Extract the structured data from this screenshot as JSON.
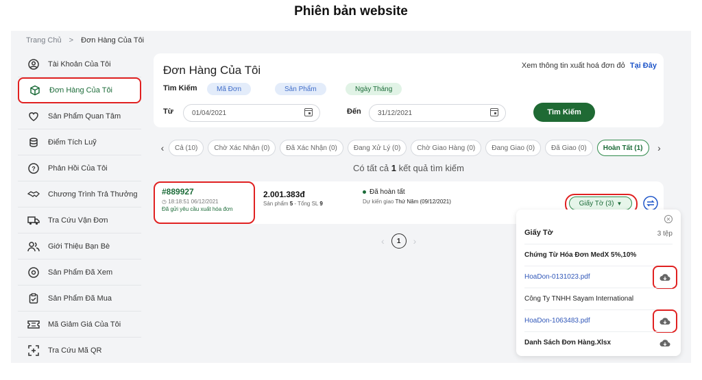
{
  "page_heading": "Phiên bản website",
  "breadcrumb": {
    "home": "Trang Chủ",
    "separator": ">",
    "current": "Đơn Hàng Của Tôi"
  },
  "sidebar": {
    "items": [
      {
        "label": "Tài Khoản Của Tôi",
        "icon": "user-circle-icon"
      },
      {
        "label": "Đơn Hàng Của Tôi",
        "icon": "box-icon"
      },
      {
        "label": "Sản Phẩm Quan Tâm",
        "icon": "heart-icon"
      },
      {
        "label": "Điểm Tích Luỹ",
        "icon": "coins-icon"
      },
      {
        "label": "Phản Hồi Của Tôi",
        "icon": "question-icon"
      },
      {
        "label": "Chương Trình Trả Thưởng",
        "icon": "handshake-icon"
      },
      {
        "label": "Tra Cứu Vận Đơn",
        "icon": "truck-icon"
      },
      {
        "label": "Giới Thiệu Bạn Bè",
        "icon": "users-icon"
      },
      {
        "label": "Sản Phẩm Đã Xem",
        "icon": "eye-icon"
      },
      {
        "label": "Sản Phẩm Đã Mua",
        "icon": "clipboard-icon"
      },
      {
        "label": "Mã Giảm Giá Của Tôi",
        "icon": "ticket-icon"
      },
      {
        "label": "Tra Cứu Mã QR",
        "icon": "qr-scan-icon"
      }
    ]
  },
  "search": {
    "title": "Đơn Hàng Của Tôi",
    "invoice_note": "Xem thông tin xuất hoá đơn đỏ",
    "invoice_link": "Tại Đây",
    "search_label": "Tìm Kiếm",
    "chips": [
      "Mã Đơn",
      "Sản Phẩm",
      "Ngày Tháng"
    ],
    "from_label": "Từ",
    "from_value": "01/04/2021",
    "to_label": "Đến",
    "to_value": "31/12/2021",
    "button": "Tìm Kiếm"
  },
  "tabs": [
    "Cả (10)",
    "Chờ Xác Nhận (0)",
    "Đã Xác Nhận (0)",
    "Đang Xử Lý (0)",
    "Chờ Giao Hàng (0)",
    "Đang Giao (0)",
    "Đã Giao (0)",
    "Hoàn Tất (1)"
  ],
  "results": {
    "prefix": "Có tất cả",
    "count": "1",
    "suffix": "kết quả tìm kiếm"
  },
  "order": {
    "id": "#889927",
    "time": "18:18:51 06/12/2021",
    "invoice_request": "Đã gửi yêu cầu xuất hóa đơn",
    "amount": "2.001.383đ",
    "qty_prefix": "Sản phẩm",
    "qty_products": "5",
    "qty_mid": "- Tổng SL",
    "qty_total": "9",
    "status": "Đã hoàn tất",
    "eta_label": "Dự kiến giao",
    "eta_value": "Thứ Năm (09/12/2021)",
    "docs_button": "Giấy Tờ (3)"
  },
  "pagination": {
    "current": "1"
  },
  "docs_popup": {
    "title": "Giấy Tờ",
    "count": "3 tệp",
    "rows": [
      {
        "text": "Chứng Từ Hóa Đơn MedX 5%,10%",
        "kind": "group"
      },
      {
        "text": "HoaDon-0131023.pdf",
        "kind": "file"
      },
      {
        "text": "Công Ty TNHH Sayam International",
        "kind": "group-normal"
      },
      {
        "text": "HoaDon-1063483.pdf",
        "kind": "file"
      },
      {
        "text": "Danh Sách Đơn Hàng.Xlsx",
        "kind": "group"
      }
    ]
  },
  "colors": {
    "brand_green": "#1f6a34",
    "highlight_red": "#e02020",
    "link_blue": "#2f56b8"
  }
}
